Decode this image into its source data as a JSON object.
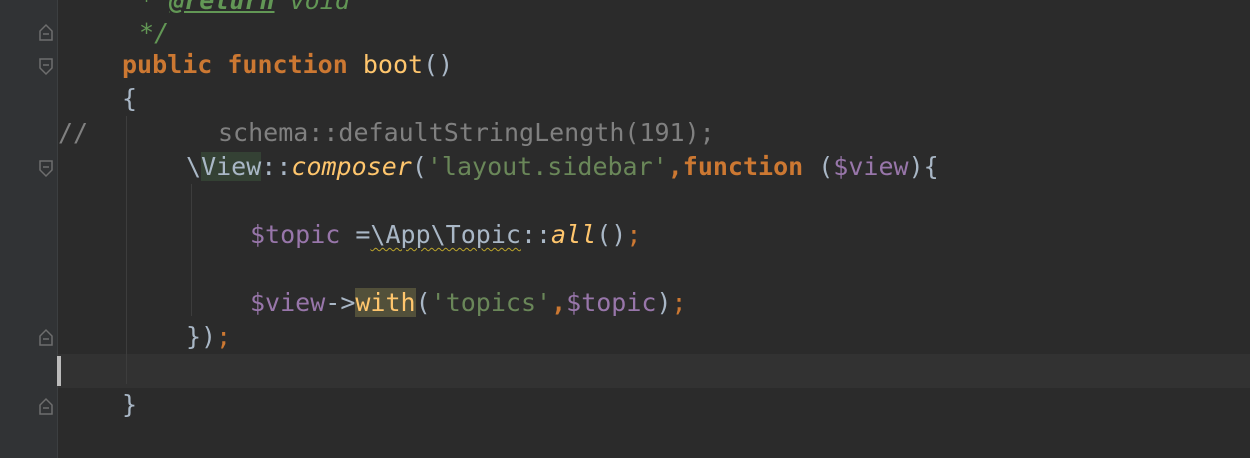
{
  "editor": {
    "lines": {
      "doc_return": {
        "prefix": " * ",
        "tag": "@return",
        "type": " void"
      },
      "doc_end": " */",
      "sig": {
        "kw_public": "public",
        "kw_function": "function",
        "name": "boot",
        "parens": "()"
      },
      "open_brace": "{",
      "comment_line": {
        "marker": "//",
        "code": "schema::defaultStringLength(",
        "number": "191",
        "close": ");"
      },
      "composer": {
        "backslash": "\\",
        "cls": "View",
        "sep": "::",
        "method": "composer",
        "paren_open": "(",
        "str": "'layout.sidebar'",
        "comma": ",",
        "kw_function": "function",
        "space_paren": " (",
        "var": "$view",
        "close": "){"
      },
      "topic": {
        "var": "$topic",
        "eq": " =",
        "ns": "\\App\\Topic",
        "sep": "::",
        "method": "all",
        "parens": "()",
        "semi": ";"
      },
      "view_with": {
        "var": "$view",
        "arrow": "->",
        "method": "with",
        "paren_open": "(",
        "str": "'topics'",
        "comma": ",",
        "arg": "$topic",
        "close": ")",
        "semi": ";"
      },
      "close_closure": {
        "text": "})",
        "semi": ";"
      },
      "close_method": "}"
    }
  }
}
